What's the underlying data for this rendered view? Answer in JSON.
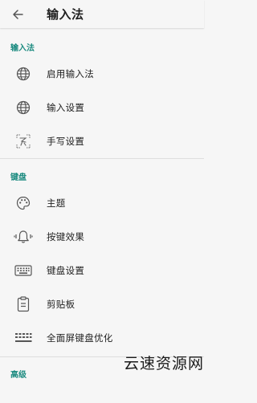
{
  "app_bar": {
    "title": "输入法"
  },
  "sections": [
    {
      "header": "输入法",
      "items": [
        {
          "label": "启用输入法",
          "icon": "globe-icon"
        },
        {
          "label": "输入设置",
          "icon": "globe-icon"
        },
        {
          "label": "手写设置",
          "icon": "handwriting-icon"
        }
      ]
    },
    {
      "header": "键盘",
      "items": [
        {
          "label": "主题",
          "icon": "palette-icon"
        },
        {
          "label": "按键效果",
          "icon": "bell-vibrate-icon"
        },
        {
          "label": "键盘设置",
          "icon": "keyboard-icon"
        },
        {
          "label": "剪贴板",
          "icon": "clipboard-icon"
        },
        {
          "label": "全面屏键盘优化",
          "icon": "fullscreen-keyboard-icon"
        }
      ]
    },
    {
      "header": "高级",
      "items": []
    }
  ],
  "watermark": "云速资源网",
  "colors": {
    "accent": "#1a8a7f",
    "background": "#f6f6f6",
    "text": "#222222",
    "icon": "#555555"
  }
}
